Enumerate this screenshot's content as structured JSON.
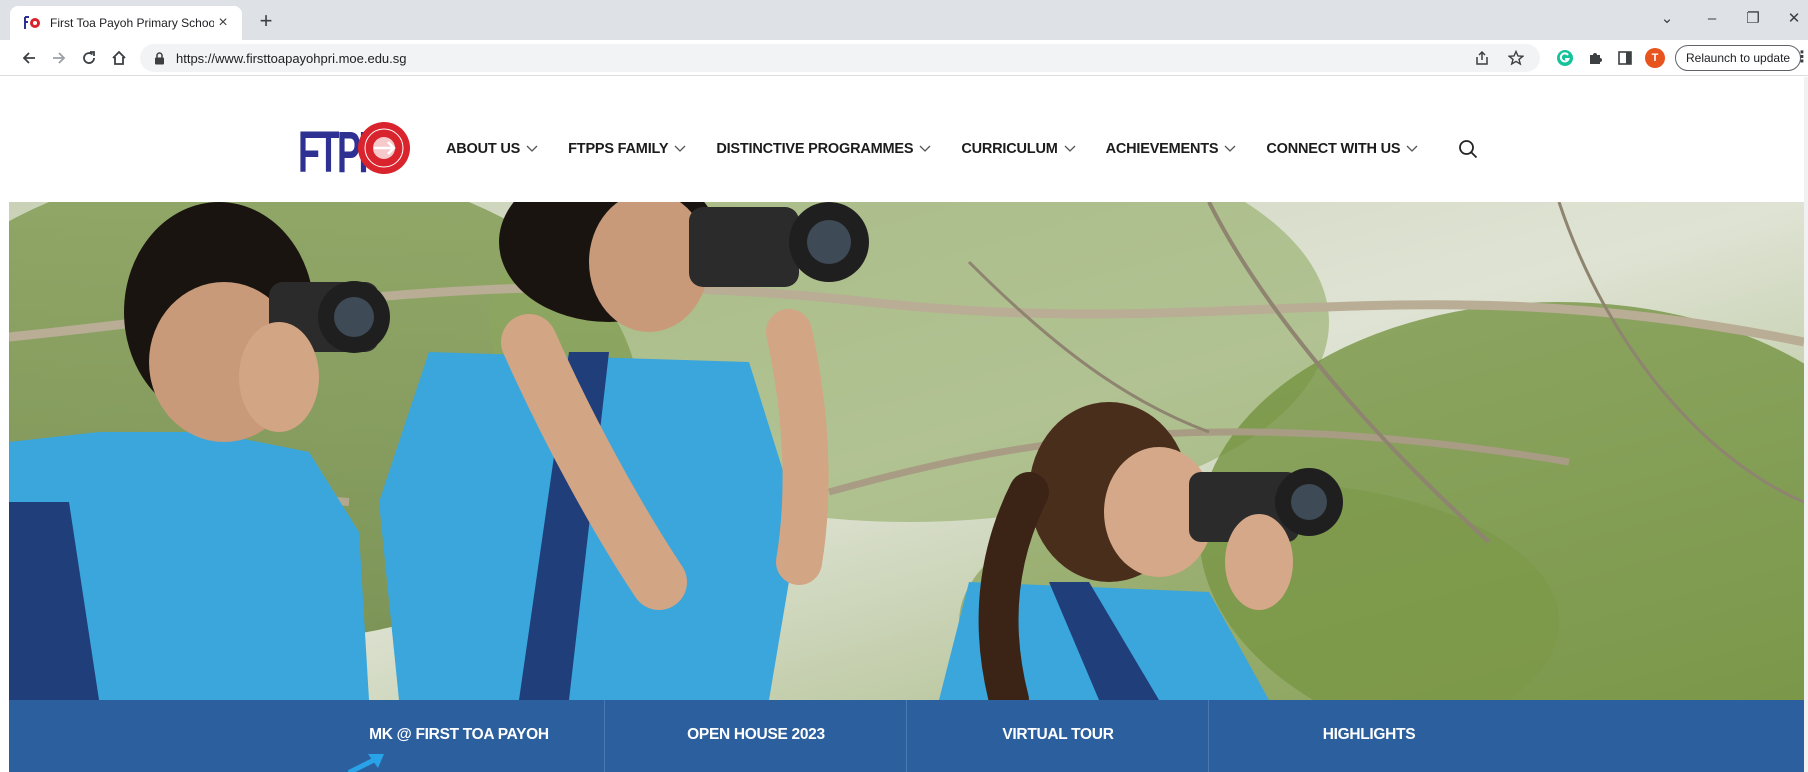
{
  "browser": {
    "tab_title": "First Toa Payoh Primary School",
    "tab_close": "×",
    "new_tab": "+",
    "url": "https://www.firsttoapayohpri.moe.edu.sg",
    "relaunch_label": "Relaunch to update",
    "profile_initial": "T",
    "window_controls": {
      "dropdown": "⌄",
      "minimize": "–",
      "restore": "❐",
      "close": "✕"
    }
  },
  "site": {
    "logo_text": "FTPP",
    "logo_seal_text": "FIRST TOA PAYOH PRIMARY SCHOOL",
    "nav": [
      {
        "label": "ABOUT US"
      },
      {
        "label": "FTPPS FAMILY"
      },
      {
        "label": "DISTINCTIVE PROGRAMMES"
      },
      {
        "label": "CURRICULUM"
      },
      {
        "label": "ACHIEVEMENTS"
      },
      {
        "label": "CONNECT WITH US"
      }
    ]
  },
  "quick_links": [
    {
      "label": "MK @ FIRST TOA PAYOH"
    },
    {
      "label": "OPEN HOUSE 2023"
    },
    {
      "label": "VIRTUAL TOUR"
    },
    {
      "label": "HIGHLIGHTS"
    }
  ],
  "colors": {
    "quick_links_bg": "#2c5f9e",
    "logo_blue": "#2e3192",
    "logo_red": "#d9232d",
    "uniform_blue": "#3aa6dc"
  }
}
